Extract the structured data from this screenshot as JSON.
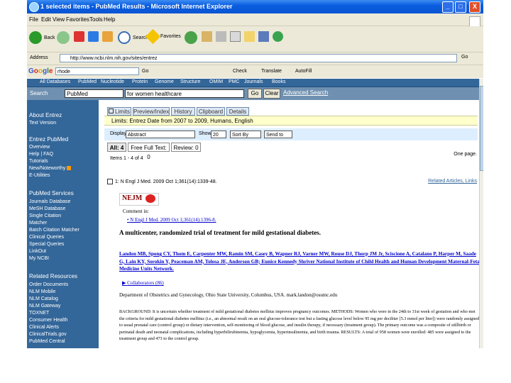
{
  "window": {
    "title": "1 selected items - PubMed Results - Microsoft Internet Explorer",
    "controls": [
      "_",
      "□",
      "X"
    ]
  },
  "menu": [
    "File",
    "Edit",
    "View",
    "Favorites",
    "Tools",
    "Help"
  ],
  "toolbar": {
    "back": "Back",
    "search": "Search",
    "favorites": "Favorites"
  },
  "address": {
    "label": "Address",
    "value": "http://www.ncbi.nlm.nih.gov/sites/entrez",
    "go": "Go"
  },
  "google_bar": {
    "logo": "Google",
    "query": "rhode",
    "items": [
      "Go",
      "Check",
      "Translate",
      "AutoFill"
    ]
  },
  "ncbi_nav": [
    "All Databases",
    "PubMed",
    "Nucleotide",
    "Protein",
    "Genome",
    "Structure",
    "OMIM",
    "PMC",
    "Journals",
    "Books"
  ],
  "search": {
    "label": "Search",
    "db": "PubMed",
    "for_label": "for",
    "query": "women healthcare",
    "go": "Go",
    "clear": "Clear",
    "advanced": "Advanced Search"
  },
  "sidebar": {
    "sections": [
      {
        "heading": "About Entrez",
        "items": [
          "Text Version"
        ]
      },
      {
        "heading": "Entrez PubMed",
        "items": [
          "Overview",
          "Help | FAQ",
          "Tutorials",
          "New/Noteworthy",
          "E-Utilities"
        ]
      },
      {
        "heading": "PubMed Services",
        "items": [
          "Journals Database",
          "MeSH Database",
          "Single Citation",
          "Matcher",
          "Batch Citation Matcher",
          "Clinical Queries",
          "Special Queries",
          "LinkOut",
          "My NCBI"
        ]
      },
      {
        "heading": "Related Resources",
        "items": [
          "Order Documents",
          "NLM Mobile",
          "NLM Catalog",
          "NLM Gateway",
          "TOXNET",
          "Consumer Health",
          "Clinical Alerts",
          "ClinicalTrials.gov",
          "PubMed Central"
        ]
      }
    ]
  },
  "tabs": [
    "Limits",
    "Preview/Index",
    "History",
    "Clipboard",
    "Details"
  ],
  "limits_text": "Limits: Entrez Date from 2007 to 2009, Humans, English",
  "display": {
    "label": "Display",
    "format": "Abstract",
    "show_label": "Show",
    "show": "20",
    "sort_label": "Sort By",
    "send": "Send to"
  },
  "filters": [
    "All: 4",
    "Free Full Text: 0",
    "Review: 0"
  ],
  "items_text": "Items 1 - 4 of 4",
  "one_page": "One page.",
  "citation": "1: N Engl J Med. 2009 Oct 1;361(14):1339-48.",
  "related_links": "Related Articles, Links",
  "journal_logo": "NEJM",
  "comment_in": "Comment in:",
  "comment_link": "N Engl J Med. 2009 Oct 1;361(14):1396-8.",
  "article_title": "A multicenter, randomized trial of treatment for mild gestational diabetes.",
  "authors": "Landon MB, Spong CY, Thom E, Carpenter MW, Ramin SM, Casey B, Wapner RJ, Varner MW, Rouse DJ, Thorp JM Jr, Sciscione A, Catalano P, Harper M, Saade G, Lain KY, Sorokin Y, Peaceman AM, Tolosa JE, Anderson GB; Eunice Kennedy Shriver National Institute of Child Health and Human Development Maternal-Fetal Medicine Units Network.",
  "collaborators": "Collaborators (86)",
  "affiliation": "Department of Obstetrics and Gynecology, Ohio State University, Columbus, USA. mark.landon@osumc.edu",
  "abstract": "BACKGROUND: It is uncertain whether treatment of mild gestational diabetes mellitus improves pregnancy outcomes. METHODS: Women who were in the 24th to 31st week of gestation and who met the criteria for mild gestational diabetes mellitus (i.e., an abnormal result on an oral glucose-tolerance test but a fasting glucose level below 95 mg per deciliter [5.3 mmol per liter]) were randomly assigned to usual prenatal care (control group) or dietary intervention, self-monitoring of blood glucose, and insulin therapy, if necessary (treatment group). The primary outcome was a composite of stillbirth or perinatal death and neonatal complications, including hyperbilirubinemia, hypoglycemia, hyperinsulinemia, and birth trauma. RESULTS: A total of 958 women were enrolled: 485 were assigned to the treatment group and 473 to the control group."
}
